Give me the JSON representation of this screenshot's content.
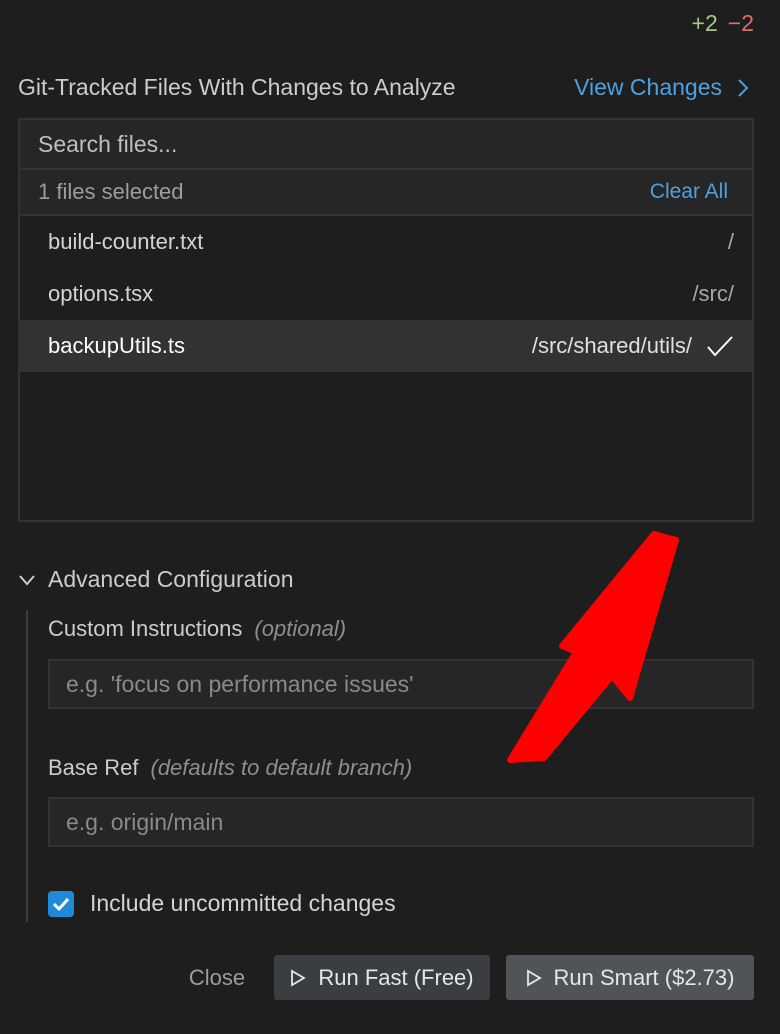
{
  "diff": {
    "added": "+2",
    "removed": "−2"
  },
  "header": {
    "title": "Git-Tracked Files With Changes to Analyze",
    "view_changes": "View Changes"
  },
  "search": {
    "placeholder": "Search files..."
  },
  "selection": {
    "count_text": "1 files selected",
    "clear_all": "Clear All"
  },
  "files": [
    {
      "name": "build-counter.txt",
      "path": "/",
      "selected": false
    },
    {
      "name": "options.tsx",
      "path": "/src/",
      "selected": false
    },
    {
      "name": "backupUtils.ts",
      "path": "/src/shared/utils/",
      "selected": true
    }
  ],
  "advanced": {
    "title": "Advanced Configuration",
    "custom_instructions": {
      "label": "Custom Instructions",
      "hint": "(optional)",
      "placeholder": "e.g. 'focus on performance issues'"
    },
    "base_ref": {
      "label": "Base Ref",
      "hint": "(defaults to default branch)",
      "placeholder": "e.g. origin/main"
    },
    "include_uncommitted": {
      "label": "Include uncommitted changes",
      "checked": true
    }
  },
  "footer": {
    "close": "Close",
    "run_fast": "Run Fast (Free)",
    "run_smart": "Run Smart ($2.73)"
  },
  "colors": {
    "accent": "#4da1e0",
    "checkbox": "#1f8ad8",
    "annotation": "#ff0000",
    "diff_add": "#a5c98a",
    "diff_remove": "#e06c6c"
  },
  "icons": {
    "view_changes": "chevron-right-icon",
    "advanced": "chevron-down-icon",
    "selected_file": "checkmark-icon",
    "run_buttons": "play-icon",
    "annotation": "red-arrow-icon"
  }
}
